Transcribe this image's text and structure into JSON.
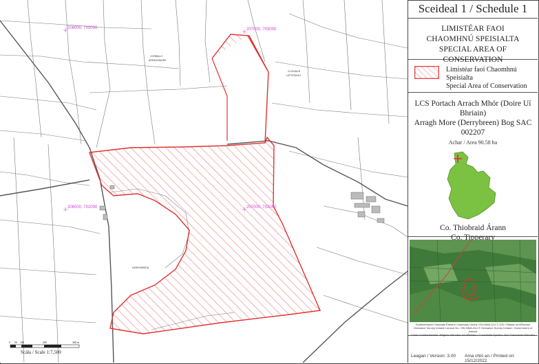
{
  "schedule_title": "Sceideal 1 / Schedule 1",
  "designation": {
    "line1": "LIMISTÉAR FAOI",
    "line2": "CHAOMHNÚ SPEISIALTA",
    "line3": "SPECIAL AREA OF CONSERVATION"
  },
  "legend": {
    "line1": "Limistéar faoi Chaomhnú Speisialta",
    "line2": "Special Area of Conservation",
    "swatch_color": "#e03030"
  },
  "site": {
    "line1": "LCS Portach Arrach Mhór (Doire Uí Bhriain)",
    "line2": "Arragh More (Derrybreen) Bog SAC",
    "code": "002207",
    "area": "Achar / Area 90.58 ha"
  },
  "county": {
    "line1": "Co. Thiobraid Árann",
    "line2": "Co. Tipperary"
  },
  "footer": {
    "line1": "Suirbhéireacht Ordanáis Éireann Ceadúnas Uimhir OSI-NMA-014 © OSi / Rialtas na hÉireann",
    "line2": "Ordnance Survey Ireland Licence No. OSI-NMA-014 © Ordnance Survey Ireland / Government of Ireland",
    "line3": "Córas Comhordanáidí: Teilgeán Mercator na hÉireann / Coordinate System: Irish Transverse Mercator"
  },
  "version": "Leagan / Version: 3.00",
  "printed": "Ama chló an / Printed on: 15/12/2022",
  "scale": {
    "label": "Scála / Scale 1:7,500",
    "ticks": [
      "0",
      "50",
      "100",
      "200",
      "300 m"
    ]
  },
  "grid_labels": [
    "206000, 703000",
    "207000, 703000",
    "206000, 702000",
    "207000, 702000"
  ],
  "townlands": [
    "CORBALLY",
    "ARRAGHMORE",
    "CLODIAGH",
    "LATTERAGH",
    "DERRYBREEN"
  ],
  "colors": {
    "sac_boundary": "#e03030",
    "grid_label": "#d040d0",
    "inset_background": "#3f7a3a"
  }
}
